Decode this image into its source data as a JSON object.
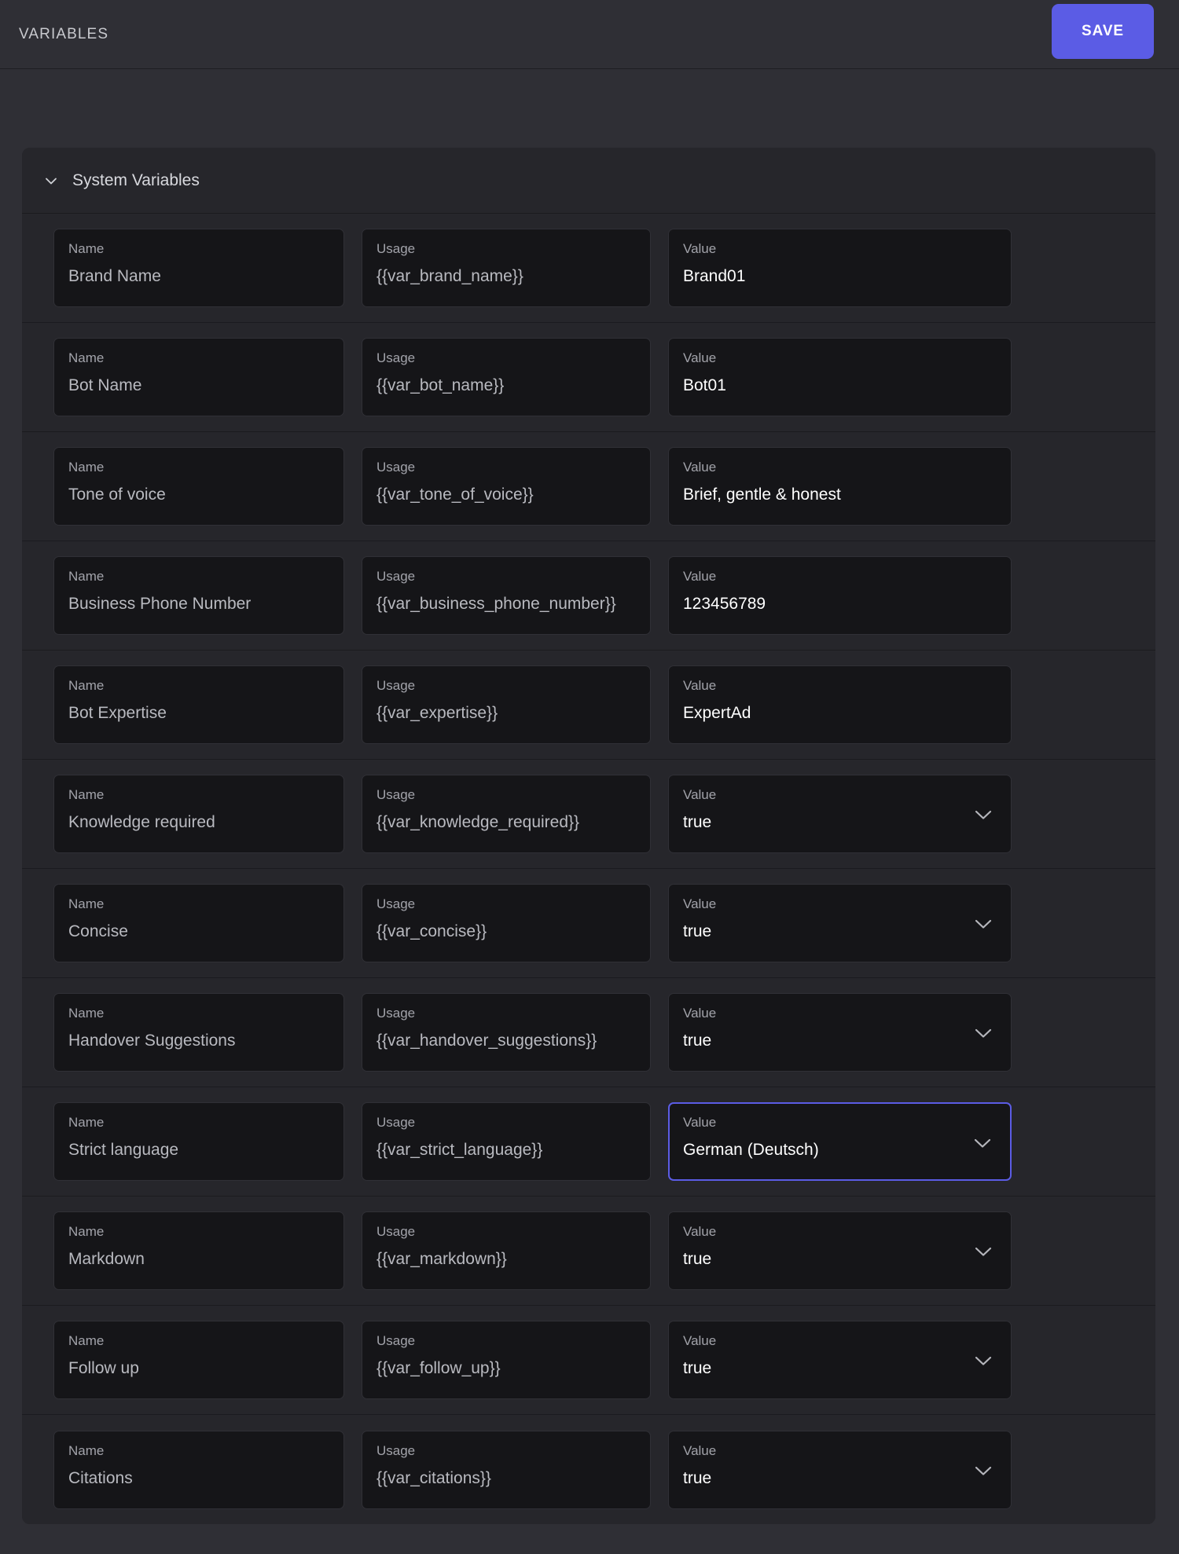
{
  "topbar": {
    "title": "VARIABLES",
    "save_label": "SAVE",
    "accent_color": "#5b5ce5"
  },
  "group": {
    "title": "System Variables",
    "collapse_icon": "chevron-down-icon",
    "expanded": true
  },
  "labels": {
    "name": "Name",
    "usage": "Usage",
    "value": "Value"
  },
  "rows": [
    {
      "name": "Brand Name",
      "usage": "{{var_brand_name}}",
      "value": "Brand01",
      "control": "text",
      "focused": false
    },
    {
      "name": "Bot Name",
      "usage": "{{var_bot_name}}",
      "value": "Bot01",
      "control": "text",
      "focused": false
    },
    {
      "name": "Tone of voice",
      "usage": "{{var_tone_of_voice}}",
      "value": "Brief, gentle & honest",
      "control": "text",
      "focused": false
    },
    {
      "name": "Business Phone Number",
      "usage": "{{var_business_phone_number}}",
      "value": "123456789",
      "control": "text",
      "focused": false
    },
    {
      "name": "Bot Expertise",
      "usage": "{{var_expertise}}",
      "value": "ExpertAd",
      "control": "text",
      "focused": false
    },
    {
      "name": "Knowledge required",
      "usage": "{{var_knowledge_required}}",
      "value": "true",
      "control": "select",
      "focused": false
    },
    {
      "name": "Concise",
      "usage": "{{var_concise}}",
      "value": "true",
      "control": "select",
      "focused": false
    },
    {
      "name": "Handover Suggestions",
      "usage": "{{var_handover_suggestions}}",
      "value": "true",
      "control": "select",
      "focused": false
    },
    {
      "name": "Strict language",
      "usage": "{{var_strict_language}}",
      "value": "German (Deutsch)",
      "control": "select",
      "focused": true
    },
    {
      "name": "Markdown",
      "usage": "{{var_markdown}}",
      "value": "true",
      "control": "select",
      "focused": false
    },
    {
      "name": "Follow up",
      "usage": "{{var_follow_up}}",
      "value": "true",
      "control": "select",
      "focused": false
    },
    {
      "name": "Citations",
      "usage": "{{var_citations}}",
      "value": "true",
      "control": "select",
      "focused": false
    }
  ]
}
